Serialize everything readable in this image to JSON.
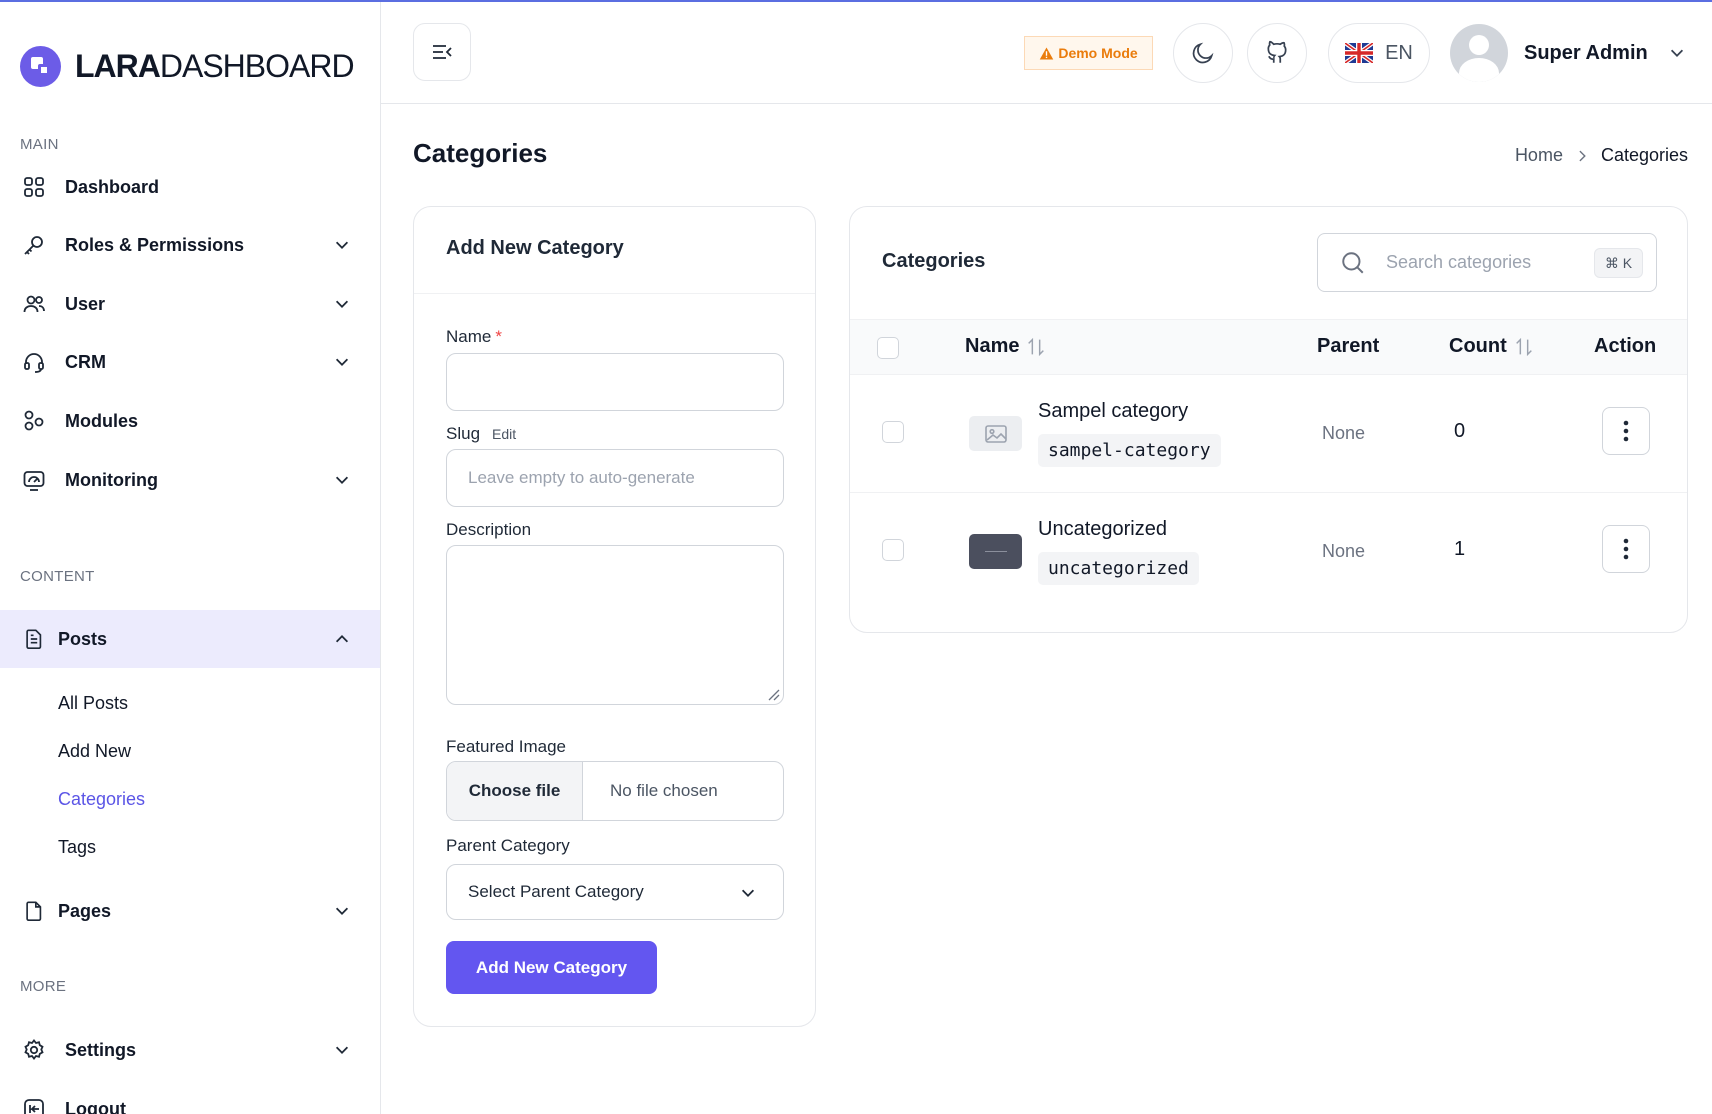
{
  "brand": {
    "bold": "LARA",
    "light": "DASHBOARD"
  },
  "sidebar": {
    "sections": {
      "main": "MAIN",
      "content": "CONTENT",
      "more": "MORE"
    },
    "items": [
      {
        "label": "Dashboard",
        "icon": "grid-icon"
      },
      {
        "label": "Roles & Permissions",
        "icon": "key-icon"
      },
      {
        "label": "User",
        "icon": "users-icon"
      },
      {
        "label": "CRM",
        "icon": "headset-icon"
      },
      {
        "label": "Modules",
        "icon": "modules-icon"
      },
      {
        "label": "Monitoring",
        "icon": "monitor-icon"
      },
      {
        "label": "Posts",
        "icon": "document-icon"
      },
      {
        "label": "Pages",
        "icon": "file-icon"
      },
      {
        "label": "Settings",
        "icon": "gear-icon"
      },
      {
        "label": "Logout",
        "icon": "logout-icon"
      }
    ],
    "posts_sub": [
      "All Posts",
      "Add New",
      "Categories",
      "Tags"
    ]
  },
  "header": {
    "demo_badge": "Demo Mode",
    "language": "EN",
    "user_name": "Super Admin"
  },
  "page": {
    "title": "Categories",
    "breadcrumb": {
      "home": "Home",
      "current": "Categories"
    }
  },
  "form": {
    "title": "Add New Category",
    "name_label": "Name",
    "required_mark": "*",
    "slug_label": "Slug",
    "slug_edit": "Edit",
    "slug_placeholder": "Leave empty to auto-generate",
    "description_label": "Description",
    "featured_label": "Featured Image",
    "file_button": "Choose file",
    "file_status": "No file chosen",
    "parent_label": "Parent Category",
    "parent_selected": "Select Parent Category",
    "submit": "Add New Category"
  },
  "list": {
    "title": "Categories",
    "search_placeholder": "Search categories",
    "search_shortcut": "⌘ K",
    "columns": {
      "name": "Name",
      "parent": "Parent",
      "count": "Count",
      "action": "Action"
    },
    "rows": [
      {
        "name": "Sampel category",
        "slug": "sampel-category",
        "parent": "None",
        "count": "0"
      },
      {
        "name": "Uncategorized",
        "slug": "uncategorized",
        "parent": "None",
        "count": "1"
      }
    ]
  },
  "colors": {
    "accent": "#6356f0",
    "active_bg": "#ecebfd",
    "demo_orange": "#ea7c0c"
  }
}
